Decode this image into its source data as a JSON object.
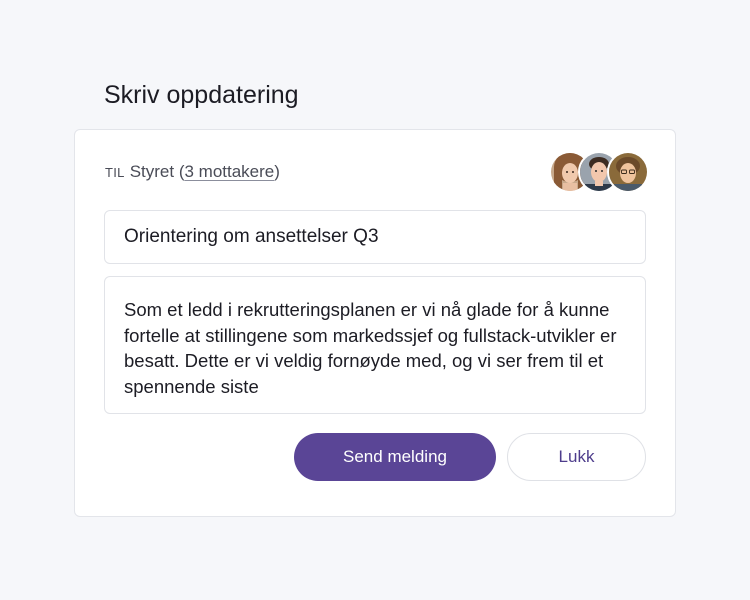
{
  "page": {
    "title": "Skriv oppdatering"
  },
  "recipients": {
    "prefix": "TIL",
    "group": "Styret",
    "open_paren": " (",
    "count_link": "3 mottakere",
    "close_paren": ")",
    "avatars": [
      "avatar-1",
      "avatar-2",
      "avatar-3"
    ]
  },
  "subject": {
    "value": "Orientering om ansettelser Q3"
  },
  "message": {
    "value": "Som et ledd i rekrutteringsplanen er vi nå glade for å kunne fortelle at stillingene som markedssjef og fullstack-utvikler er besatt. Dette er vi veldig fornøyde med, og vi ser frem til et spennende siste"
  },
  "actions": {
    "send_label": "Send melding",
    "close_label": "Lukk"
  },
  "colors": {
    "accent": "#5a4596",
    "background": "#f6f7fa",
    "card": "#ffffff",
    "border": "#e1e3e8"
  }
}
